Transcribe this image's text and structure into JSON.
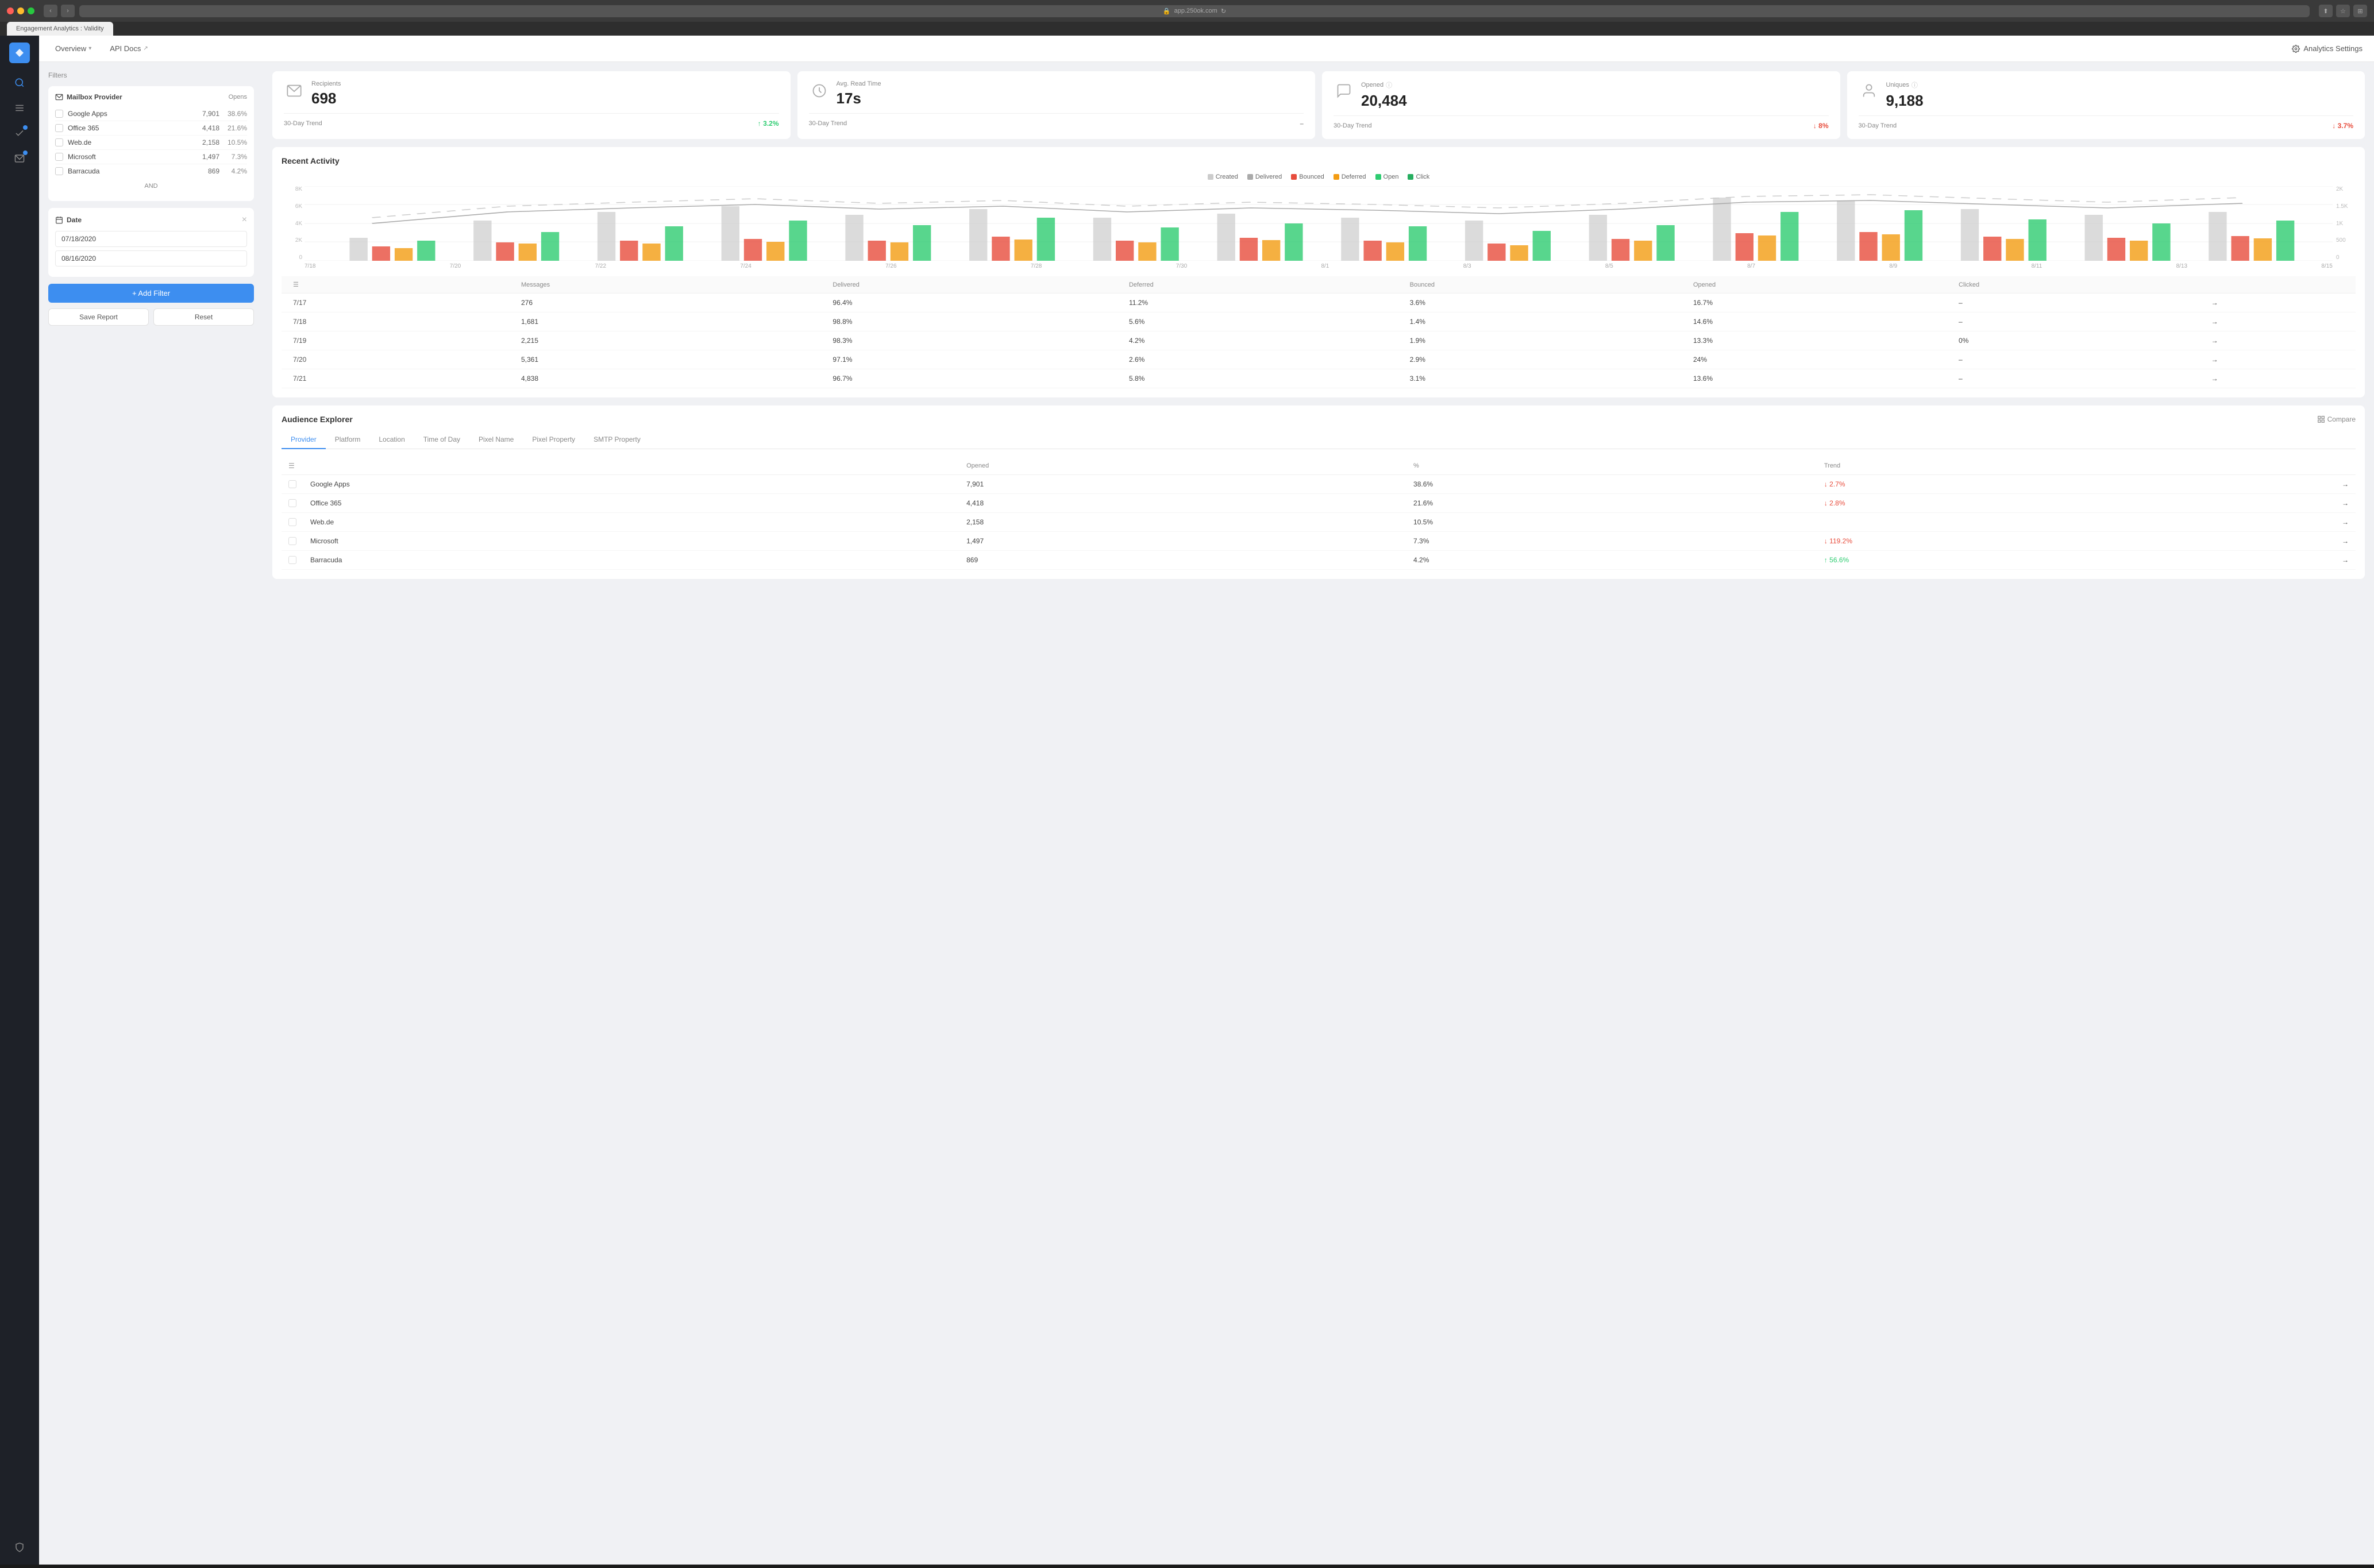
{
  "browser": {
    "url": "app.250ok.com",
    "tab_title": "Engagement Analytics : Validity"
  },
  "nav": {
    "overview_label": "Overview",
    "api_docs_label": "API Docs",
    "analytics_settings_label": "Analytics Settings"
  },
  "filters": {
    "title": "Filters",
    "mailbox_provider": {
      "title": "Mailbox Provider",
      "action": "Opens",
      "items": [
        {
          "label": "Google Apps",
          "count": "7,901",
          "pct": "38.6%"
        },
        {
          "label": "Office 365",
          "count": "4,418",
          "pct": "21.6%"
        },
        {
          "label": "Web.de",
          "count": "2,158",
          "pct": "10.5%"
        },
        {
          "label": "Microsoft",
          "count": "1,497",
          "pct": "7.3%"
        },
        {
          "label": "Barracuda",
          "count": "869",
          "pct": "4.2%"
        }
      ],
      "and_label": "AND"
    },
    "date": {
      "title": "Date",
      "start": "07/18/2020",
      "end": "08/16/2020"
    },
    "add_filter": "+ Add Filter",
    "save_report": "Save Report",
    "reset": "Reset"
  },
  "stats": [
    {
      "icon": "recipients-icon",
      "label": "Recipients",
      "value": "698",
      "trend_label": "30-Day Trend",
      "trend_value": "3.2%",
      "trend_dir": "up"
    },
    {
      "icon": "clock-icon",
      "label": "Avg. Read Time",
      "value": "17s",
      "trend_label": "30-Day Trend",
      "trend_value": "–",
      "trend_dir": "neutral"
    },
    {
      "icon": "opened-icon",
      "label": "Opened",
      "value": "20,484",
      "trend_label": "30-Day Trend",
      "trend_value": "8%",
      "trend_dir": "down",
      "has_info": true
    },
    {
      "icon": "uniques-icon",
      "label": "Uniques",
      "value": "9,188",
      "trend_label": "30-Day Trend",
      "trend_value": "3.7%",
      "trend_dir": "down",
      "has_info": true
    }
  ],
  "recent_activity": {
    "title": "Recent Activity",
    "legend": [
      {
        "label": "Created",
        "color": "#cccccc"
      },
      {
        "label": "Delivered",
        "color": "#aaaaaa"
      },
      {
        "label": "Bounced",
        "color": "#e74c3c"
      },
      {
        "label": "Deferred",
        "color": "#f39c12"
      },
      {
        "label": "Open",
        "color": "#2ecc71"
      },
      {
        "label": "Click",
        "color": "#27ae60"
      }
    ],
    "x_labels": [
      "7/18",
      "7/20",
      "7/22",
      "7/24",
      "7/26",
      "7/28",
      "7/30",
      "8/1",
      "8/3",
      "8/5",
      "8/7",
      "8/9",
      "8/11",
      "8/13",
      "8/15"
    ],
    "y_left": [
      "8K",
      "6K",
      "4K",
      "2K",
      "0"
    ],
    "y_right": [
      "2K",
      "1.5K",
      "1K",
      "500",
      "0"
    ]
  },
  "table": {
    "columns": [
      "",
      "Messages",
      "Delivered",
      "Deferred",
      "Bounced",
      "Opened",
      "Clicked",
      ""
    ],
    "rows": [
      {
        "date": "7/17",
        "messages": "276",
        "delivered": "96.4%",
        "deferred": "11.2%",
        "bounced": "3.6%",
        "opened": "16.7%",
        "clicked": "–"
      },
      {
        "date": "7/18",
        "messages": "1,681",
        "delivered": "98.8%",
        "deferred": "5.6%",
        "bounced": "1.4%",
        "opened": "14.6%",
        "clicked": "–"
      },
      {
        "date": "7/19",
        "messages": "2,215",
        "delivered": "98.3%",
        "deferred": "4.2%",
        "bounced": "1.9%",
        "opened": "13.3%",
        "clicked": "0%"
      },
      {
        "date": "7/20",
        "messages": "5,361",
        "delivered": "97.1%",
        "deferred": "2.6%",
        "bounced": "2.9%",
        "opened": "24%",
        "clicked": "–"
      },
      {
        "date": "7/21",
        "messages": "4,838",
        "delivered": "96.7%",
        "deferred": "5.8%",
        "bounced": "3.1%",
        "opened": "13.6%",
        "clicked": "–"
      }
    ]
  },
  "audience": {
    "title": "Audience Explorer",
    "compare_label": "Compare",
    "tabs": [
      {
        "label": "Provider",
        "active": true
      },
      {
        "label": "Platform",
        "active": false
      },
      {
        "label": "Location",
        "active": false
      },
      {
        "label": "Time of Day",
        "active": false
      },
      {
        "label": "Pixel Name",
        "active": false
      },
      {
        "label": "Pixel Property",
        "active": false
      },
      {
        "label": "SMTP Property",
        "active": false
      }
    ],
    "columns": [
      "",
      "Opened",
      "%",
      "Trend",
      ""
    ],
    "rows": [
      {
        "label": "Google Apps",
        "opened": "7,901",
        "pct": "38.6%",
        "trend": "↓ 2.7%",
        "trend_dir": "down"
      },
      {
        "label": "Office 365",
        "opened": "4,418",
        "pct": "21.6%",
        "trend": "↓ 2.8%",
        "trend_dir": "down"
      },
      {
        "label": "Web.de",
        "opened": "2,158",
        "pct": "10.5%",
        "trend": "",
        "trend_dir": "neutral"
      },
      {
        "label": "Microsoft",
        "opened": "1,497",
        "pct": "7.3%",
        "trend": "↓ 119.2%",
        "trend_dir": "down"
      },
      {
        "label": "Barracuda",
        "opened": "869",
        "pct": "4.2%",
        "trend": "↑ 56.6%",
        "trend_dir": "up"
      }
    ]
  }
}
